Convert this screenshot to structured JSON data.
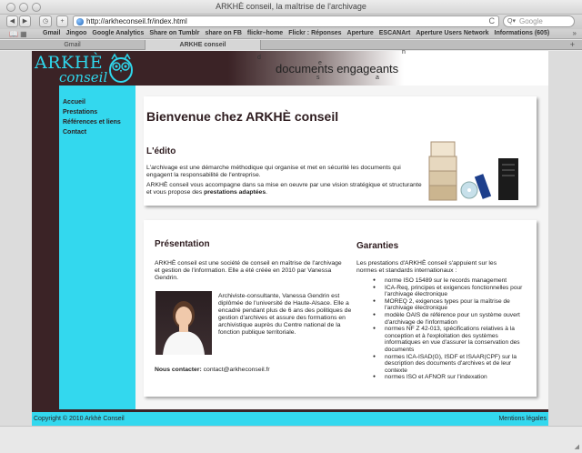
{
  "window": {
    "title": "ARKHÈ conseil, la maîtrise de l'archivage"
  },
  "toolbar": {
    "back": "◀",
    "forward": "▶",
    "history": "◷",
    "add": "+",
    "url": "http://arkheconseil.fr/index.html",
    "reload": "C",
    "search_icon": "Q▾",
    "search_placeholder": "Google"
  },
  "bookmarks": {
    "icons": "📖 ▦",
    "items": [
      "Gmail",
      "Jingoo",
      "Google Analytics",
      "Share on Tumblr",
      "share on FB",
      "flickr–home",
      "Flickr : Réponses",
      "Aperture",
      "ESCANArt",
      "Aperture Users Network",
      "Informations (605)"
    ],
    "more": "»"
  },
  "tabs": [
    {
      "label": "Gmail"
    },
    {
      "label": "ARKHE conseil"
    }
  ],
  "tab_add": "+",
  "site": {
    "logo_main": "ARKHÈ",
    "logo_sub": "conseil",
    "tagline": "documents engageants",
    "scatter": [
      "d",
      "e",
      "s",
      "n",
      "a"
    ],
    "menu": [
      "Accueil",
      "Prestations",
      "Références et liens",
      "Contact"
    ],
    "welcome": {
      "title": "Bienvenue chez ARKHÈ conseil",
      "edito_heading": "L'édito",
      "para1": "L'archivage est une démarche méthodique qui organise et met en sécurité les documents qui engagent la responsabilité de l'entreprise.",
      "para2_prefix": "ARKHÈ conseil vous accompagne dans sa mise en oeuvre par une vision stratégique et structurante et vous propose des ",
      "para2_bold": "prestations adaptées",
      "para2_suffix": "."
    },
    "presentation": {
      "heading": "Présentation",
      "intro": "ARKHÈ conseil est une société de conseil en maîtrise de l'archivage et gestion de l'information. Elle a été créée en 2010 par Vanessa Gendrin.",
      "bio": "Archiviste-consultante, Vanessa Gendrin est diplômée de l'université de Haute-Alsace. Elle a encadré pendant plus de 6 ans des politiques de gestion d'archives et assure des formations en archivistique auprès du Centre national de la fonction publique territoriale.",
      "contact_label": "Nous contacter:",
      "contact_email": "contact@arkheconseil.fr"
    },
    "garanties": {
      "heading": "Garanties",
      "intro": "Les prestations d'ARKHÈ conseil s'appuient sur les normes et standards internationaux :",
      "items": [
        "norme ISO 15489 sur le records management",
        "ICA-Req, principes et exigences fonctionnelles pour l'archivage électronique",
        "MOREQ 2, exigences types pour la maîtrise de l'archivage électronique",
        "modèle OAIS de référence pour un système ouvert d'archivage de l'information",
        "normes NF Z 42-013, spécifications relatives à la conception et à l'exploitation des systèmes informatiques en vue d'assurer la conservation des documents",
        "normes ICA-ISAD(G), ISDF et ISAAR(CPF) sur la description des documents d'archives et de leur contexte",
        "normes ISO et AFNOR sur l'indexation"
      ]
    },
    "footer": {
      "copyright": "Copyright © 2010 Arkhè Conseil",
      "legal": "Mentions légales"
    }
  },
  "colors": {
    "brown": "#3b2326",
    "cyan": "#33d8ee",
    "logo": "#2fd7ec"
  }
}
